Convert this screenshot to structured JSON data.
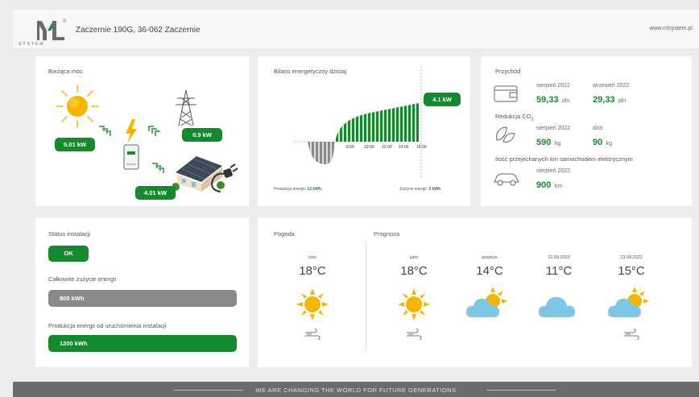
{
  "header": {
    "logo_sub": "SYSTEM",
    "logo_reg": "®",
    "address": "Zaczernie 190G, 36-062 Zaczernie",
    "website": "www.mlsystem.pl"
  },
  "current_power": {
    "title": "Bieżąca moc",
    "solar": "5.01 kW",
    "grid": "0.9 kW",
    "house": "4.01 kW"
  },
  "balance": {
    "title": "Bilans energetyczny dzisiaj",
    "badge": "4.1 kW",
    "production_label": "Produkcja energii:",
    "production_value": "12 kWh",
    "consumption_label": "Zużycie energii:",
    "consumption_value": "3 kWh",
    "ticks": [
      "8:00",
      "10:00",
      "12:00",
      "14:00",
      "16:00"
    ]
  },
  "income": {
    "title": "Przychód",
    "items": [
      {
        "period": "sierpień 2022",
        "value": "59,33",
        "unit": "pln"
      },
      {
        "period": "wrzesień 2022",
        "value": "29,33",
        "unit": "pln"
      }
    ],
    "co2_title": "Redukcja CO",
    "co2_sub": "2",
    "co2_items": [
      {
        "period": "sierpień 2022",
        "value": "590",
        "unit": "kg"
      },
      {
        "period": "dziś",
        "value": "90",
        "unit": "kg"
      }
    ],
    "km_title": "Ilość przejechanych km samochodem elektrycznym",
    "km_item": {
      "period": "sierpień 2022",
      "value": "900",
      "unit": "km"
    }
  },
  "status": {
    "title": "Status instalacji",
    "ok": "OK",
    "total_title": "Całkowite zużycie energii",
    "total_value": "800 kWh",
    "prod_title": "Produkcja energii od uruchomienia instalacji",
    "prod_value": "1200 kWh"
  },
  "weather": {
    "title": "Pogoda",
    "forecast_title": "Prognoza",
    "days": [
      {
        "day": "dziś",
        "temp": "18°C",
        "icon": "sun-icon"
      },
      {
        "day": "jutro",
        "temp": "18°C",
        "icon": "sun-icon"
      },
      {
        "day": "pojutrze",
        "temp": "14°C",
        "icon": "cloud-sun-icon"
      },
      {
        "day": "22.09.2022",
        "temp": "11°C",
        "icon": "cloud-icon"
      },
      {
        "day": "23.09.2022",
        "temp": "15°C",
        "icon": "cloud-sun-icon"
      }
    ]
  },
  "footer": {
    "text": "WE ARE CHANGING THE WORLD FOR FUTURE GENERATIONS"
  },
  "colors": {
    "accent": "#148a2f",
    "sun": "#f5b400",
    "cloud": "#7fc7e6"
  }
}
